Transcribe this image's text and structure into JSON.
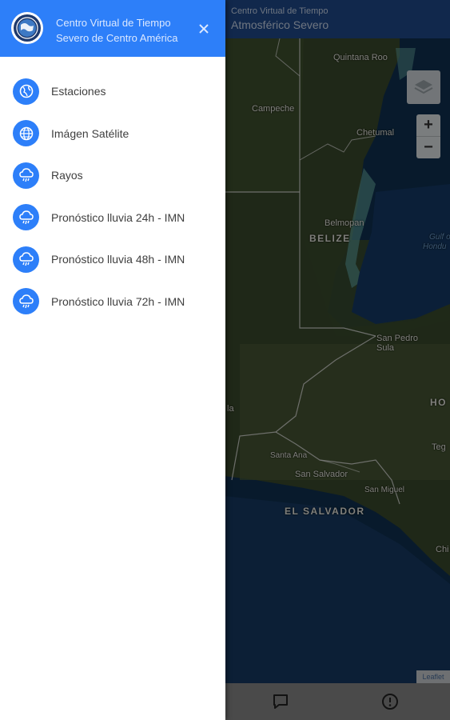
{
  "app": {
    "title_line1": "Centro Virtual de Tiempo",
    "title_line2": "Atmosférico Severo"
  },
  "map": {
    "labels": {
      "quintana_roo": "Quintana Roo",
      "campeche": "Campeche",
      "chetumal": "Chetumal",
      "belmopan": "Belmopan",
      "belize": "BELIZE",
      "gulf_line1": "Gulf o",
      "gulf_line2": "Hondu",
      "san_pedro_line1": "San Pedro",
      "san_pedro_line2": "Sula",
      "hon": "HO",
      "teg": "Teg",
      "la": "la",
      "santa_ana": "Santa Ana",
      "san_salvador": "San Salvador",
      "san_miguel": "San Miguel",
      "el_salvador": "EL SALVADOR",
      "chi": "Chi"
    },
    "zoom_in": "+",
    "zoom_out": "−",
    "attribution": "Leaflet",
    "layers_icon": "layers-icon"
  },
  "bottom_bar": {
    "icons": [
      "chat-icon",
      "alert-circle-icon"
    ]
  },
  "drawer": {
    "title_line1": "Centro Virtual de Tiempo",
    "title_line2": "Severo de Centro América",
    "close_icon": "close-icon",
    "items": [
      {
        "label": "Estaciones",
        "icon": "globe-pin-icon"
      },
      {
        "label": "Imágen Satélite",
        "icon": "globe-icon"
      },
      {
        "label": "Rayos",
        "icon": "storm-cloud-icon"
      },
      {
        "label": "Pronóstico lluvia 24h - IMN",
        "icon": "rain-cloud-icon"
      },
      {
        "label": "Pronóstico lluvia 48h - IMN",
        "icon": "rain-cloud-icon"
      },
      {
        "label": "Pronóstico lluvia 72h - IMN",
        "icon": "rain-cloud-icon"
      }
    ]
  },
  "colors": {
    "primary": "#2d7ff9",
    "app_header": "#1f4a8a",
    "drawer_bg": "#ffffff",
    "menu_text": "#3f3f3f"
  }
}
